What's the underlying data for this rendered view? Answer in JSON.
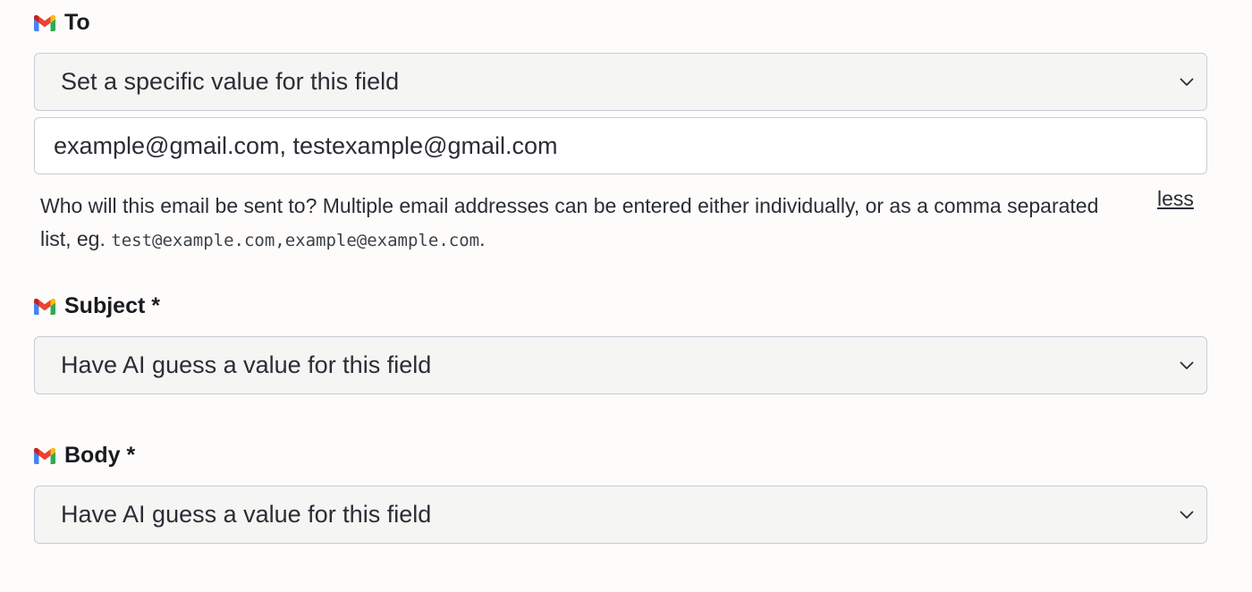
{
  "fields": {
    "to": {
      "label": "To",
      "mode": "Set a specific value for this field",
      "value": "example@gmail.com, testexample@gmail.com",
      "help_text": "Who will this email be sent to? Multiple email addresses can be entered either individually, or as a comma separated list, eg. ",
      "help_code": "test@example.com,example@example.com",
      "help_suffix": ".",
      "toggle_label": "less"
    },
    "subject": {
      "label": "Subject *",
      "mode": "Have AI guess a value for this field"
    },
    "body": {
      "label": "Body *",
      "mode": "Have AI guess a value for this field"
    }
  },
  "icons": {
    "app_icon": "gmail-icon",
    "dropdown_icon": "chevron-down-icon"
  },
  "colors": {
    "gmail_blue": "#4285f4",
    "gmail_red": "#ea4335",
    "gmail_yellow": "#fbbc05",
    "gmail_green": "#34a853"
  }
}
